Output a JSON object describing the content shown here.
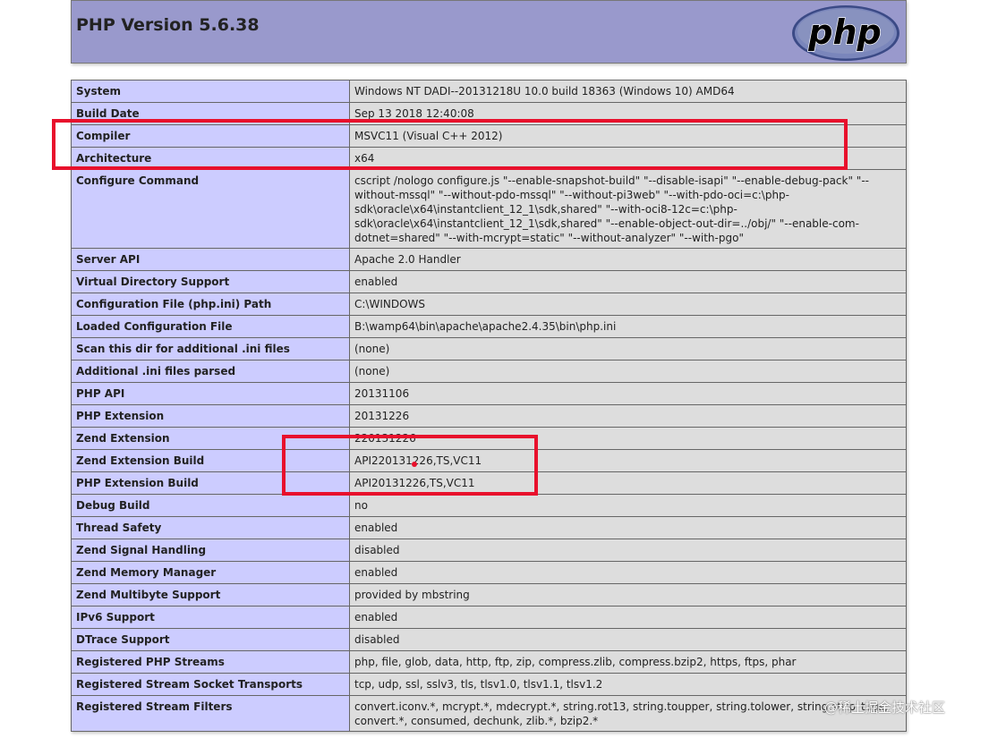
{
  "header": {
    "title": "PHP Version 5.6.38",
    "logo_text": "php"
  },
  "rows": [
    {
      "label": "System",
      "value": "Windows NT DADI--20131218U 10.0 build 18363 (Windows 10) AMD64"
    },
    {
      "label": "Build Date",
      "value": "Sep 13 2018 12:40:08"
    },
    {
      "label": "Compiler",
      "value": "MSVC11 (Visual C++ 2012)"
    },
    {
      "label": "Architecture",
      "value": "x64"
    },
    {
      "label": "Configure Command",
      "value": "cscript /nologo configure.js \"--enable-snapshot-build\" \"--disable-isapi\" \"--enable-debug-pack\" \"--without-mssql\" \"--without-pdo-mssql\" \"--without-pi3web\" \"--with-pdo-oci=c:\\php-sdk\\oracle\\x64\\instantclient_12_1\\sdk,shared\" \"--with-oci8-12c=c:\\php-sdk\\oracle\\x64\\instantclient_12_1\\sdk,shared\" \"--enable-object-out-dir=../obj/\" \"--enable-com-dotnet=shared\" \"--with-mcrypt=static\" \"--without-analyzer\" \"--with-pgo\""
    },
    {
      "label": "Server API",
      "value": "Apache 2.0 Handler"
    },
    {
      "label": "Virtual Directory Support",
      "value": "enabled"
    },
    {
      "label": "Configuration File (php.ini) Path",
      "value": "C:\\WINDOWS"
    },
    {
      "label": "Loaded Configuration File",
      "value": "B:\\wamp64\\bin\\apache\\apache2.4.35\\bin\\php.ini"
    },
    {
      "label": "Scan this dir for additional .ini files",
      "value": "(none)"
    },
    {
      "label": "Additional .ini files parsed",
      "value": "(none)"
    },
    {
      "label": "PHP API",
      "value": "20131106"
    },
    {
      "label": "PHP Extension",
      "value": "20131226"
    },
    {
      "label": "Zend Extension",
      "value": "220131226"
    },
    {
      "label": "Zend Extension Build",
      "value": "API220131226,TS,VC11"
    },
    {
      "label": "PHP Extension Build",
      "value": "API20131226,TS,VC11"
    },
    {
      "label": "Debug Build",
      "value": "no"
    },
    {
      "label": "Thread Safety",
      "value": "enabled"
    },
    {
      "label": "Zend Signal Handling",
      "value": "disabled"
    },
    {
      "label": "Zend Memory Manager",
      "value": "enabled"
    },
    {
      "label": "Zend Multibyte Support",
      "value": "provided by mbstring"
    },
    {
      "label": "IPv6 Support",
      "value": "enabled"
    },
    {
      "label": "DTrace Support",
      "value": "disabled"
    },
    {
      "label": "Registered PHP Streams",
      "value": "php, file, glob, data, http, ftp, zip, compress.zlib, compress.bzip2, https, ftps, phar"
    },
    {
      "label": "Registered Stream Socket Transports",
      "value": "tcp, udp, ssl, sslv3, tls, tlsv1.0, tlsv1.1, tlsv1.2"
    },
    {
      "label": "Registered Stream Filters",
      "value": "convert.iconv.*, mcrypt.*, mdecrypt.*, string.rot13, string.toupper, string.tolower, string.strip_tags, convert.*, consumed, dechunk, zlib.*, bzip2.*"
    }
  ],
  "watermark": "@稀土掘金技术社区",
  "colors": {
    "header_bg": "#9999cc",
    "label_bg": "#ccccff",
    "value_bg": "#dddddd",
    "highlight": "#e8102c"
  }
}
